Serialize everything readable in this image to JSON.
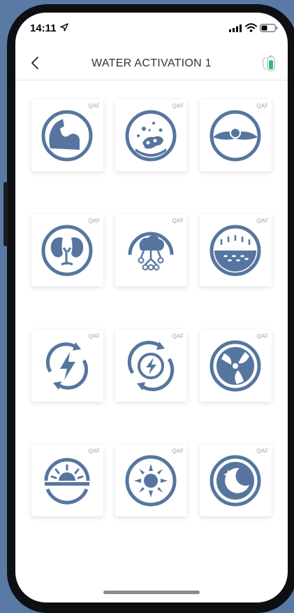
{
  "status_bar": {
    "time": "14:11"
  },
  "nav": {
    "title": "WATER ACTIVATION 1"
  },
  "tiles": [
    {
      "tag": "QAF",
      "icon": "muscle-icon"
    },
    {
      "tag": "QAF",
      "icon": "bacteria-icon"
    },
    {
      "tag": "QAF",
      "icon": "eye-icon"
    },
    {
      "tag": "QAF",
      "icon": "kidneys-icon"
    },
    {
      "tag": "QAF",
      "icon": "brain-icon"
    },
    {
      "tag": "QAF",
      "icon": "skin-icon"
    },
    {
      "tag": "QAF",
      "icon": "energy-cycle-icon"
    },
    {
      "tag": "QAF",
      "icon": "energy-circle-icon"
    },
    {
      "tag": "QAF",
      "icon": "tri-swirl-icon"
    },
    {
      "tag": "QAF",
      "icon": "sunrise-icon"
    },
    {
      "tag": "QAF",
      "icon": "sun-icon"
    },
    {
      "tag": "QAF",
      "icon": "moon-icon"
    }
  ],
  "colors": {
    "icon": "#56769f",
    "accent_green": "#2fbf71"
  }
}
